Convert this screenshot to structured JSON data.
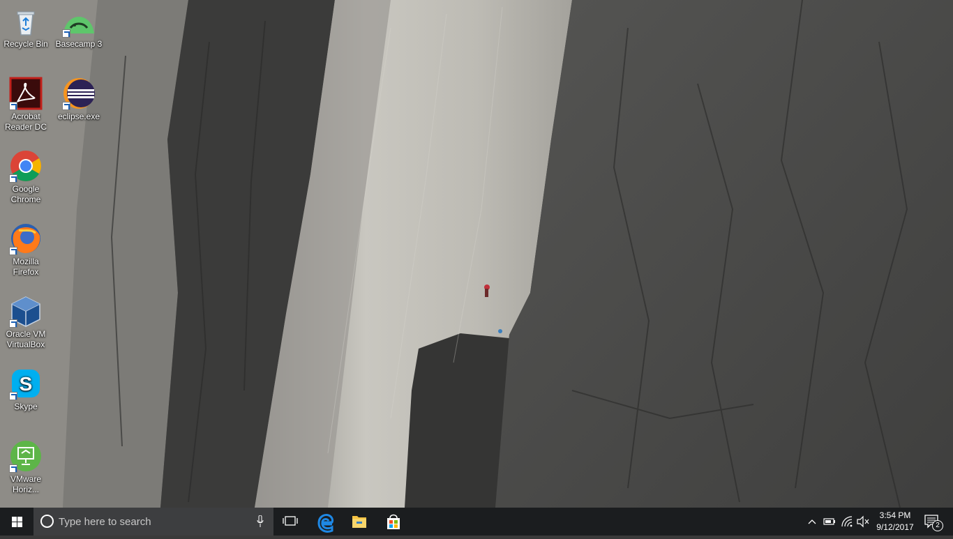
{
  "desktop": {
    "icons": [
      {
        "label": "Recycle Bin",
        "icon": "recycle-bin-icon"
      },
      {
        "label": "Basecamp 3",
        "icon": "basecamp-icon"
      },
      {
        "label": "Acrobat Reader DC",
        "icon": "acrobat-icon"
      },
      {
        "label": "eclipse.exe",
        "icon": "eclipse-icon"
      },
      {
        "label": "Google Chrome",
        "icon": "chrome-icon"
      },
      {
        "label": "Mozilla Firefox",
        "icon": "firefox-icon"
      },
      {
        "label": "Oracle VM VirtualBox",
        "icon": "virtualbox-icon"
      },
      {
        "label": "Skype",
        "icon": "skype-icon"
      },
      {
        "label": "VMware Horiz...",
        "icon": "vmware-horizon-icon"
      }
    ]
  },
  "taskbar": {
    "search_placeholder": "Type here to search",
    "pinned": [
      "task-view-icon",
      "edge-icon",
      "file-explorer-icon",
      "store-icon"
    ],
    "clock_time": "3:54 PM",
    "clock_date": "9/12/2017",
    "notification_count": "2"
  },
  "colors": {
    "taskbar_bg": "#1b1d1f",
    "search_bg": "#3d3e40",
    "edge_blue": "#1e88e5",
    "folder_yellow": "#f6c342"
  }
}
